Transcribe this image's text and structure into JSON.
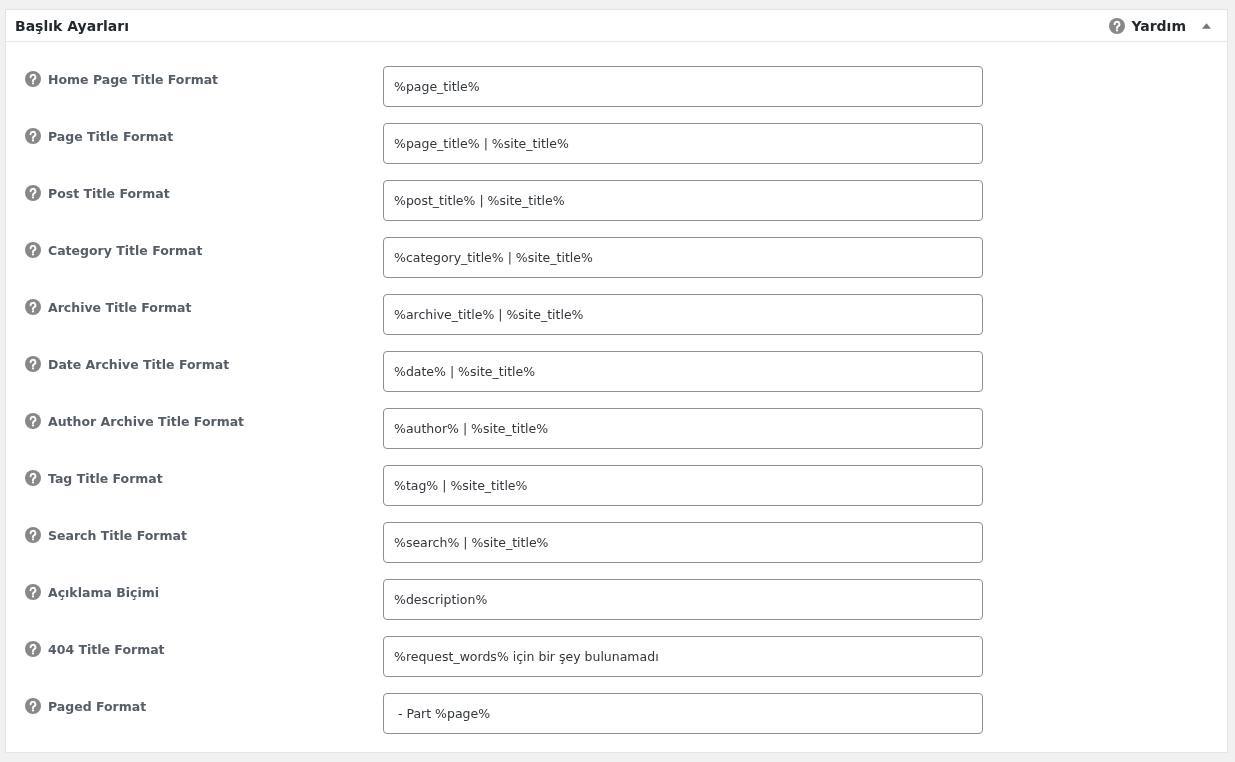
{
  "panel": {
    "title": "Başlık Ayarları",
    "help_label": "Yardım",
    "expanded": true
  },
  "fields": [
    {
      "label": "Home Page Title Format",
      "value": "%page_title%"
    },
    {
      "label": "Page Title Format",
      "value": "%page_title% | %site_title%"
    },
    {
      "label": "Post Title Format",
      "value": "%post_title% | %site_title%"
    },
    {
      "label": "Category Title Format",
      "value": "%category_title% | %site_title%"
    },
    {
      "label": "Archive Title Format",
      "value": "%archive_title% | %site_title%"
    },
    {
      "label": "Date Archive Title Format",
      "value": "%date% | %site_title%"
    },
    {
      "label": "Author Archive Title Format",
      "value": "%author% | %site_title%"
    },
    {
      "label": "Tag Title Format",
      "value": "%tag% | %site_title%"
    },
    {
      "label": "Search Title Format",
      "value": "%search% | %site_title%"
    },
    {
      "label": "Açıklama Biçimi",
      "value": "%description%"
    },
    {
      "label": "404 Title Format",
      "value": "%request_words% için bir şey bulunamadı"
    },
    {
      "label": "Paged Format",
      "value": " - Part %page%"
    }
  ]
}
